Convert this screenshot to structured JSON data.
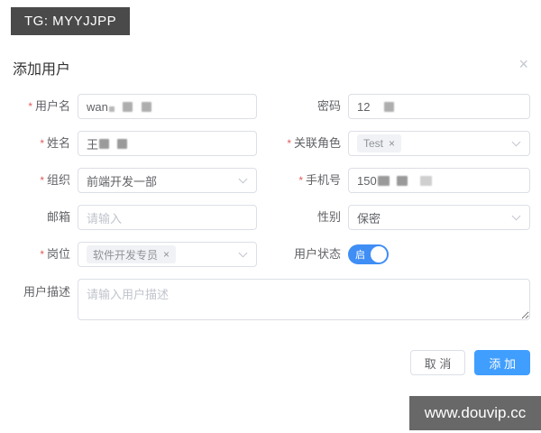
{
  "badge": {
    "text": "TG: MYYJJPP"
  },
  "modal": {
    "title": "添加用户",
    "close_icon": "×",
    "footer": {
      "cancel_label": "取 消",
      "submit_label": "添 加"
    }
  },
  "form": {
    "required_mark": "*",
    "username": {
      "label": "用户名",
      "required": true,
      "value_visible": "wan",
      "redacted": true
    },
    "password": {
      "label": "密码",
      "required": false,
      "value_visible": "12",
      "redacted": true
    },
    "name": {
      "label": "姓名",
      "required": true,
      "value_visible": "王",
      "redacted": true
    },
    "role": {
      "label": "关联角色",
      "required": true,
      "tag": "Test",
      "tag_close": "×"
    },
    "organization": {
      "label": "组织",
      "required": true,
      "value": "前端开发一部"
    },
    "phone": {
      "label": "手机号",
      "required": true,
      "value_visible": "150",
      "redacted": true
    },
    "email": {
      "label": "邮箱",
      "required": false,
      "placeholder": "请输入"
    },
    "gender": {
      "label": "性别",
      "required": false,
      "value": "保密"
    },
    "position": {
      "label": "岗位",
      "required": true,
      "tag": "软件开发专员",
      "tag_close": "×"
    },
    "status": {
      "label": "用户状态",
      "required": false,
      "switch_on_text": "启",
      "state": "on"
    },
    "description": {
      "label": "用户描述",
      "placeholder": "请输入用户描述",
      "value": ""
    }
  },
  "watermark": {
    "text": "www.douvip.cc"
  },
  "colors": {
    "accent": "#409eff",
    "switch_on": "#3f8ef5",
    "badge_bg": "#4a4a4a",
    "watermark_bg": "#5c5c5c",
    "input_border": "#dcdfe6",
    "label_text": "#606266",
    "placeholder_text": "#c0c4cc",
    "required_star": "#e25c5c",
    "tag_bg": "#f0f2f5",
    "tag_text": "#909399"
  }
}
